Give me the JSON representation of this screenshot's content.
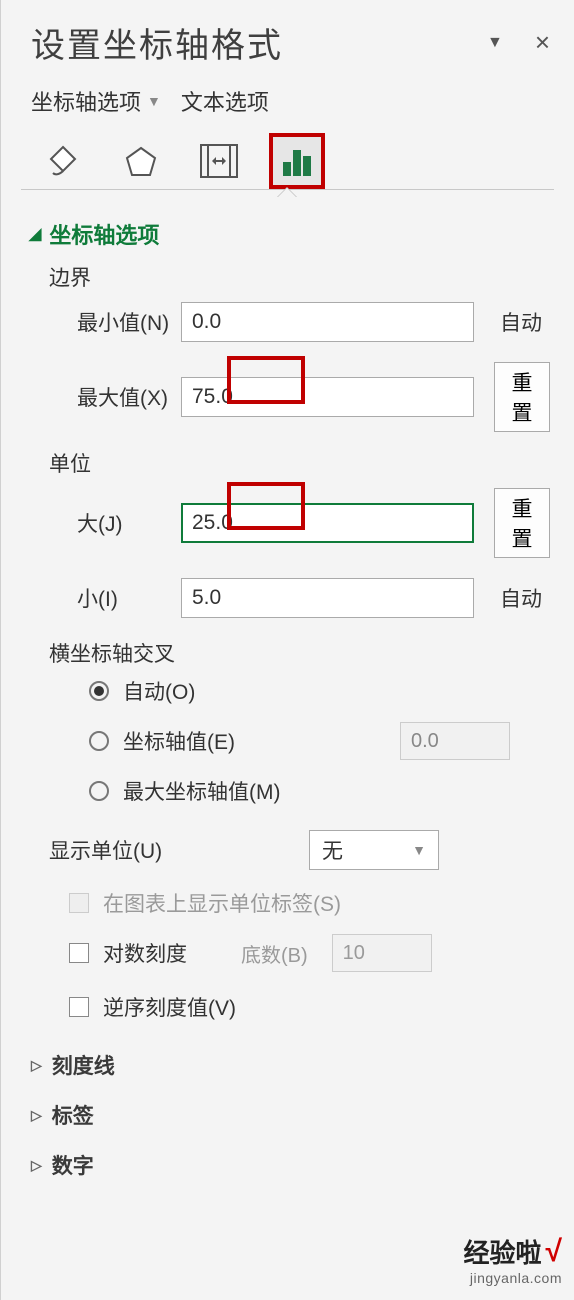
{
  "title": "设置坐标轴格式",
  "subtabs": {
    "axis_options": "坐标轴选项",
    "text_options": "文本选项"
  },
  "section_header": "坐标轴选项",
  "groups": {
    "bounds": "边界",
    "units": "单位",
    "cross": "横坐标轴交叉",
    "display_unit": "显示单位(U)",
    "ticks": "刻度线",
    "labels": "标签",
    "number": "数字"
  },
  "bounds": {
    "min_label": "最小值(N)",
    "min_value": "0.0",
    "min_action": "自动",
    "max_label": "最大值(X)",
    "max_value": "75.0",
    "max_action": "重置"
  },
  "units": {
    "major_label": "大(J)",
    "major_value": "25.0",
    "major_action": "重置",
    "minor_label": "小(I)",
    "minor_value": "5.0",
    "minor_action": "自动"
  },
  "cross": {
    "auto": "自动(O)",
    "axis_val": "坐标轴值(E)",
    "axis_val_value": "0.0",
    "max_axis": "最大坐标轴值(M)"
  },
  "display_unit": {
    "value": "无",
    "show_label": "在图表上显示单位标签(S)"
  },
  "log": {
    "label": "对数刻度",
    "base_label": "底数(B)",
    "base_value": "10"
  },
  "reverse": "逆序刻度值(V)",
  "watermark": {
    "line1": "经验啦",
    "line2": "jingyanla.com"
  }
}
